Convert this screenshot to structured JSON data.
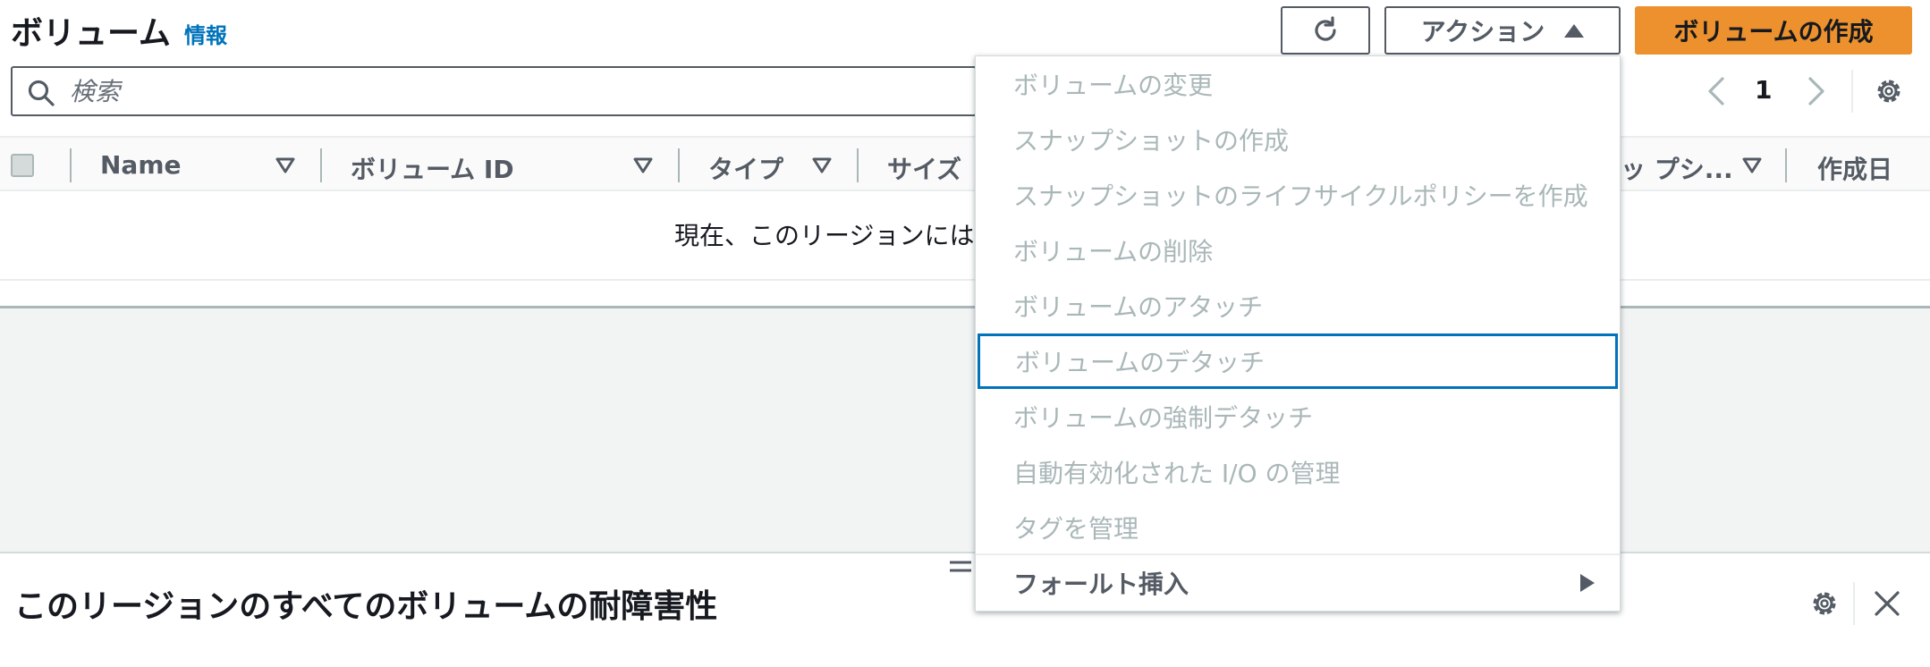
{
  "header": {
    "title": "ボリューム",
    "info_link": "情報",
    "actions_label": "アクション",
    "create_label": "ボリュームの作成"
  },
  "search": {
    "placeholder": "検索"
  },
  "pagination": {
    "current_page": "1"
  },
  "table": {
    "columns": [
      "Name",
      "ボリューム ID",
      "タイプ",
      "サイズ",
      "ッ プシ...",
      "作成日"
    ],
    "empty_message": "現在、このリージョンには"
  },
  "split_panel": {
    "title": "このリージョンのすべてのボリュームの耐障害性"
  },
  "actions_menu": {
    "items": [
      "ボリュームの変更",
      "スナップショットの作成",
      "スナップショットのライフサイクルポリシーを作成",
      "ボリュームの削除",
      "ボリュームのアタッチ",
      "ボリュームのデタッチ",
      "ボリュームの強制デタッチ",
      "自動有効化された I/O の管理",
      "タグを管理",
      "フォールト挿入"
    ]
  },
  "icons": {
    "refresh": "refresh-icon",
    "search": "search-icon",
    "settings": "gear-icon",
    "close": "close-icon"
  },
  "colors": {
    "primary_button": "#ec912e",
    "link": "#0073bb",
    "focus_border": "#0073bb",
    "disabled_text": "#aab7b8"
  }
}
